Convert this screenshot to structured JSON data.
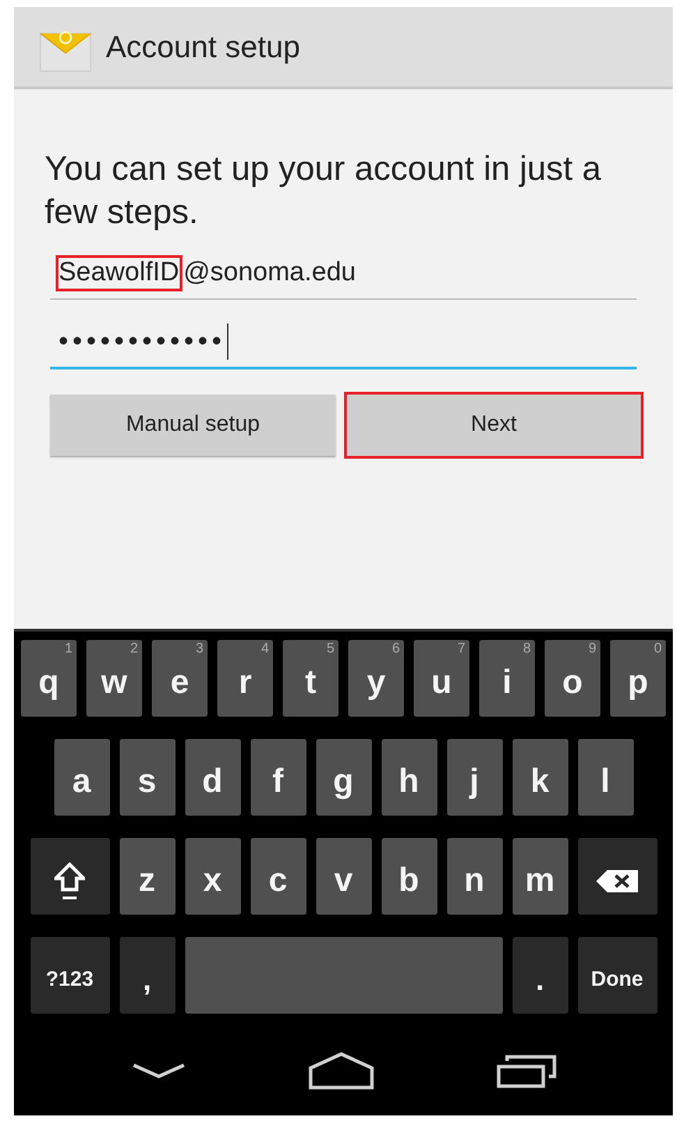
{
  "action_bar": {
    "title": "Account setup"
  },
  "intro": "You can set up your account in just a few steps.",
  "email_field": {
    "value_parts": [
      {
        "text": "SeawolfID",
        "highlighted": true
      },
      {
        "text": "@sonoma.edu",
        "highlighted": false
      }
    ],
    "focused": false
  },
  "password_field": {
    "value": "••••••••••••",
    "focused": true
  },
  "buttons": [
    {
      "label": "Manual setup",
      "highlighted": false
    },
    {
      "label": "Next",
      "highlighted": true
    }
  ],
  "keyboard": {
    "key_rows": [
      [
        {
          "kind": "letter",
          "label": "q",
          "hint": "1"
        },
        {
          "kind": "letter",
          "label": "w",
          "hint": "2"
        },
        {
          "kind": "letter",
          "label": "e",
          "hint": "3"
        },
        {
          "kind": "letter",
          "label": "r",
          "hint": "4"
        },
        {
          "kind": "letter",
          "label": "t",
          "hint": "5"
        },
        {
          "kind": "letter",
          "label": "y",
          "hint": "6"
        },
        {
          "kind": "letter",
          "label": "u",
          "hint": "7"
        },
        {
          "kind": "letter",
          "label": "i",
          "hint": "8"
        },
        {
          "kind": "letter",
          "label": "o",
          "hint": "9"
        },
        {
          "kind": "letter",
          "label": "p",
          "hint": "0"
        }
      ],
      [
        {
          "kind": "letter",
          "label": "a"
        },
        {
          "kind": "letter",
          "label": "s"
        },
        {
          "kind": "letter",
          "label": "d"
        },
        {
          "kind": "letter",
          "label": "f"
        },
        {
          "kind": "letter",
          "label": "g"
        },
        {
          "kind": "letter",
          "label": "h"
        },
        {
          "kind": "letter",
          "label": "j"
        },
        {
          "kind": "letter",
          "label": "k"
        },
        {
          "kind": "letter",
          "label": "l"
        }
      ],
      [
        {
          "kind": "shift"
        },
        {
          "kind": "letter",
          "label": "z"
        },
        {
          "kind": "letter",
          "label": "x"
        },
        {
          "kind": "letter",
          "label": "c"
        },
        {
          "kind": "letter",
          "label": "v"
        },
        {
          "kind": "letter",
          "label": "b"
        },
        {
          "kind": "letter",
          "label": "n"
        },
        {
          "kind": "letter",
          "label": "m"
        },
        {
          "kind": "backspace"
        }
      ],
      [
        {
          "kind": "function",
          "label": "?123"
        },
        {
          "kind": "function",
          "label": ","
        },
        {
          "kind": "space"
        },
        {
          "kind": "function",
          "label": "."
        },
        {
          "kind": "function",
          "label": "Done"
        }
      ]
    ]
  },
  "nav_bar": [
    {
      "kind": "back"
    },
    {
      "kind": "home"
    },
    {
      "kind": "recents"
    }
  ]
}
